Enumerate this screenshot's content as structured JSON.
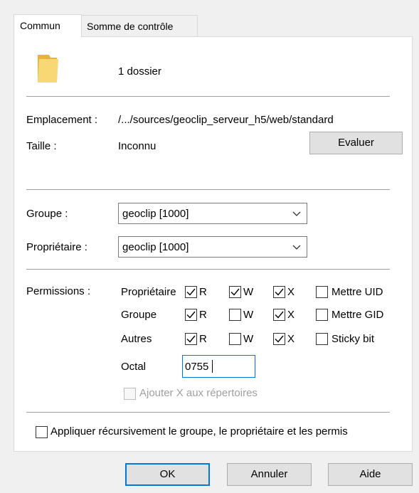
{
  "tabs": [
    {
      "label": "Commun",
      "active": true
    },
    {
      "label": "Somme de contrôle",
      "active": false
    }
  ],
  "header": {
    "icon": "folder-icon",
    "summary": "1 dossier"
  },
  "info": {
    "location_label": "Emplacement :",
    "location_value": "/.../sources/geoclip_serveur_h5/web/standard",
    "size_label": "Taille :",
    "size_value": "Inconnu",
    "evaluate_button": "Evaluer"
  },
  "ownership": {
    "group_label": "Groupe :",
    "group_value": "geoclip [1000]",
    "owner_label": "Propriétaire :",
    "owner_value": "geoclip [1000]"
  },
  "permissions": {
    "label": "Permissions :",
    "rows": [
      {
        "name": "Propriétaire",
        "r": true,
        "w": true,
        "x": true,
        "extra_label": "Mettre UID",
        "extra_checked": false
      },
      {
        "name": "Groupe",
        "r": true,
        "w": false,
        "x": true,
        "extra_label": "Mettre GID",
        "extra_checked": false
      },
      {
        "name": "Autres",
        "r": true,
        "w": false,
        "x": true,
        "extra_label": "Sticky bit",
        "extra_checked": false
      }
    ],
    "r_label": "R",
    "w_label": "W",
    "x_label": "X",
    "octal_label": "Octal",
    "octal_value": "0755",
    "add_x_label": "Ajouter X aux répertoires"
  },
  "recursive_label": "Appliquer récursivement le groupe, le propriétaire et les permis",
  "buttons": {
    "ok": "OK",
    "cancel": "Annuler",
    "help": "Aide"
  },
  "colors": {
    "accent": "#0078d7",
    "folder": "#f8d775"
  }
}
